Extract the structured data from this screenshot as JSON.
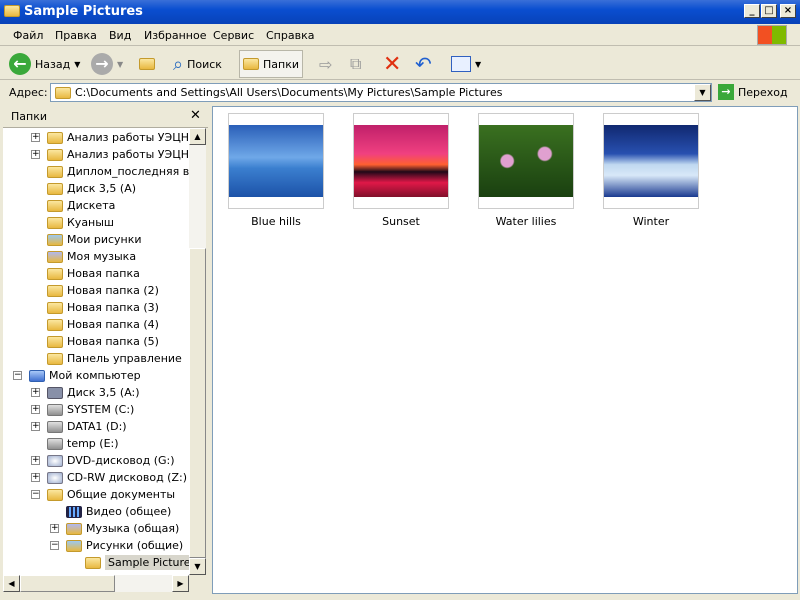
{
  "window": {
    "title": "Sample Pictures"
  },
  "menu": [
    "Файл",
    "Правка",
    "Вид",
    "Избранное",
    "Сервис",
    "Справка"
  ],
  "toolbar": {
    "back": "Назад",
    "search": "Поиск",
    "folders": "Папки"
  },
  "address": {
    "label": "Адрес:",
    "value": "C:\\Documents and Settings\\All Users\\Documents\\My Pictures\\Sample Pictures",
    "go": "Переход"
  },
  "panel": {
    "title": "Папки"
  },
  "tree": [
    {
      "label": "Анализ работы УЭЦН на",
      "level": 2,
      "expander": "+",
      "icon": "folder"
    },
    {
      "label": "Анализ работы УЭЦН на",
      "level": 2,
      "expander": "+",
      "icon": "folder"
    },
    {
      "label": "Диплом_последняя верс",
      "level": 2,
      "expander": "",
      "icon": "folder"
    },
    {
      "label": "Диск 3,5 (A)",
      "level": 2,
      "expander": "",
      "icon": "folder"
    },
    {
      "label": "Дискета",
      "level": 2,
      "expander": "",
      "icon": "folder"
    },
    {
      "label": "Куаныш",
      "level": 2,
      "expander": "",
      "icon": "folder"
    },
    {
      "label": "Мои рисунки",
      "level": 2,
      "expander": "",
      "icon": "pictures"
    },
    {
      "label": "Моя музыка",
      "level": 2,
      "expander": "",
      "icon": "music"
    },
    {
      "label": "Новая папка",
      "level": 2,
      "expander": "",
      "icon": "folder"
    },
    {
      "label": "Новая папка (2)",
      "level": 2,
      "expander": "",
      "icon": "folder"
    },
    {
      "label": "Новая папка (3)",
      "level": 2,
      "expander": "",
      "icon": "folder"
    },
    {
      "label": "Новая папка (4)",
      "level": 2,
      "expander": "",
      "icon": "folder"
    },
    {
      "label": "Новая папка (5)",
      "level": 2,
      "expander": "",
      "icon": "folder"
    },
    {
      "label": "Панель управление",
      "level": 2,
      "expander": "",
      "icon": "folder"
    },
    {
      "label": "Мой компьютер",
      "level": 1,
      "expander": "−",
      "icon": "computer"
    },
    {
      "label": "Диск 3,5 (A:)",
      "level": 2,
      "expander": "+",
      "icon": "floppy"
    },
    {
      "label": "SYSTEM (C:)",
      "level": 2,
      "expander": "+",
      "icon": "drive"
    },
    {
      "label": "DATA1 (D:)",
      "level": 2,
      "expander": "+",
      "icon": "drive"
    },
    {
      "label": "temp (E:)",
      "level": 2,
      "expander": "",
      "icon": "drive"
    },
    {
      "label": "DVD-дисковод (G:)",
      "level": 2,
      "expander": "+",
      "icon": "cd"
    },
    {
      "label": "CD-RW дисковод (Z:)",
      "level": 2,
      "expander": "+",
      "icon": "cd"
    },
    {
      "label": "Общие документы",
      "level": 2,
      "expander": "−",
      "icon": "folder"
    },
    {
      "label": "Видео (общее)",
      "level": 3,
      "expander": "",
      "icon": "video"
    },
    {
      "label": "Музыка (общая)",
      "level": 3,
      "expander": "+",
      "icon": "music"
    },
    {
      "label": "Рисунки (общие)",
      "level": 3,
      "expander": "−",
      "icon": "pictures"
    },
    {
      "label": "Sample Pictures",
      "level": 4,
      "expander": "",
      "icon": "folder",
      "selected": true
    }
  ],
  "files": [
    {
      "name": "Blue hills",
      "bg": "linear-gradient(#2a5fb8,#6fa8e8 45%,#3b7fcf 60%,#1c52a8)"
    },
    {
      "name": "Sunset",
      "bg": "linear-gradient(#c0206a,#f04080 40%,#ff6030 55%,#200818 65%,#e01848 80%,#80102a)"
    },
    {
      "name": "Water lilies",
      "bg": "radial-gradient(circle at 30% 50%,#e0a0d0 8%,transparent 10%),radial-gradient(circle at 70% 40%,#e0a0d0 8%,transparent 10%),linear-gradient(#3a7020,#1a4010)"
    },
    {
      "name": "Winter",
      "bg": "linear-gradient(#102870,#2850b0 40%,#c0d8f0 55%,#d8e8f8 70%,#1a3a90)"
    }
  ]
}
